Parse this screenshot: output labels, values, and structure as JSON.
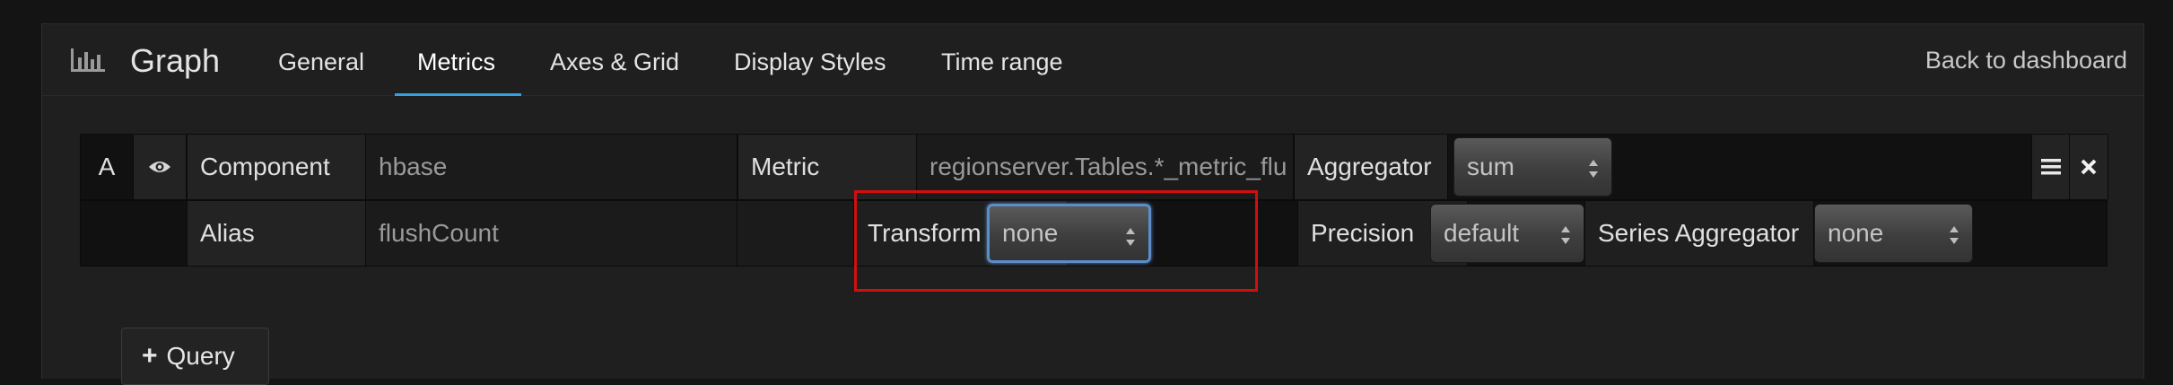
{
  "header": {
    "app_icon": "bar-chart-icon",
    "title": "Graph",
    "tabs": [
      {
        "label": "General",
        "active": false
      },
      {
        "label": "Metrics",
        "active": true
      },
      {
        "label": "Axes & Grid",
        "active": false
      },
      {
        "label": "Display Styles",
        "active": false
      },
      {
        "label": "Time range",
        "active": false
      }
    ],
    "back_label": "Back to dashboard"
  },
  "query_row": {
    "ref_id": "A",
    "visibility_icon": "eye-icon",
    "component_label": "Component",
    "component_value": "hbase",
    "metric_label": "Metric",
    "metric_value": "regionserver.Tables.*_metric_flu",
    "aggregator_label": "Aggregator",
    "aggregator_value": "sum",
    "menu_icon": "hamburger-menu-icon",
    "remove_icon": "close-icon"
  },
  "options_row": {
    "alias_label": "Alias",
    "alias_value": "flushCount",
    "transform_label": "Transform",
    "transform_value": "none",
    "precision_label": "Precision",
    "precision_value": "default",
    "series_aggregator_label": "Series Aggregator",
    "series_aggregator_value": "none"
  },
  "add_query_label": "Query",
  "colors": {
    "accent": "#33a2e5",
    "highlight": "#d10f0f",
    "focus": "#5c8dc7"
  }
}
